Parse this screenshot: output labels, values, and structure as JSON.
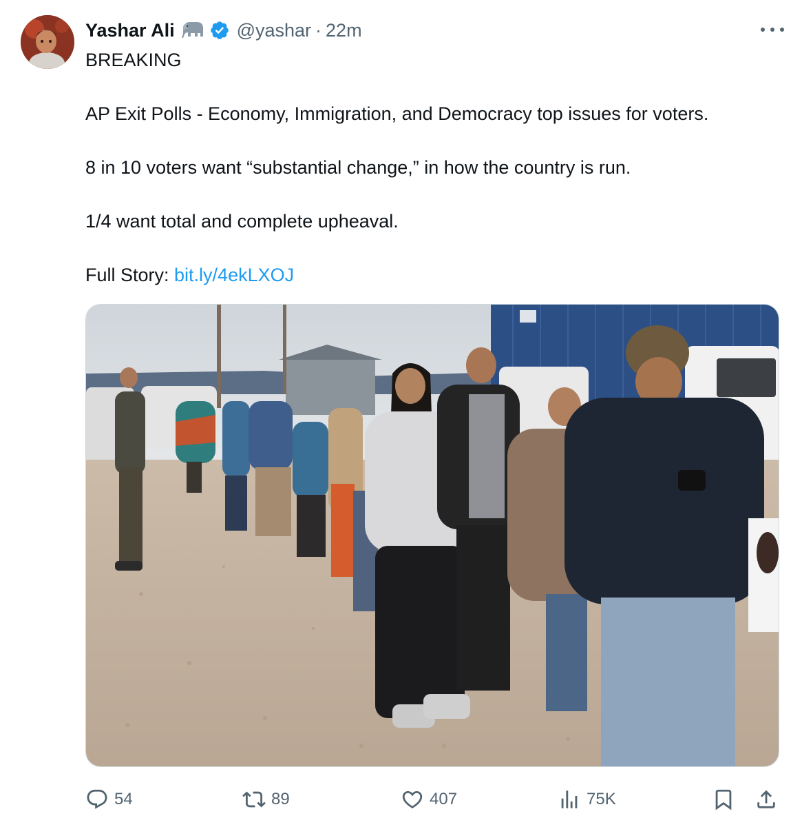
{
  "tweet": {
    "author": {
      "display_name": "Yashar Ali",
      "handle": "@yashar",
      "verified": true,
      "badge_icon": "elephant-icon"
    },
    "separator": "·",
    "time": "22m",
    "lines": [
      "BREAKING",
      "AP Exit Polls - Economy, Immigration, and Democracy top issues for voters.",
      "8 in 10 voters want “substantial change,” in how the country is run.",
      "1/4 want total and complete upheaval."
    ],
    "full_story_label": "Full Story: ",
    "link_text": "bit.ly/4ekLXOJ",
    "media_alt": "People standing in a line outdoors on a gravel lot waiting to vote"
  },
  "actions": {
    "replies": "54",
    "retweets": "89",
    "likes": "407",
    "views": "75K"
  },
  "colors": {
    "text": "#0f1419",
    "secondary": "#536471",
    "link": "#1d9bf0",
    "verified": "#1d9bf0"
  }
}
